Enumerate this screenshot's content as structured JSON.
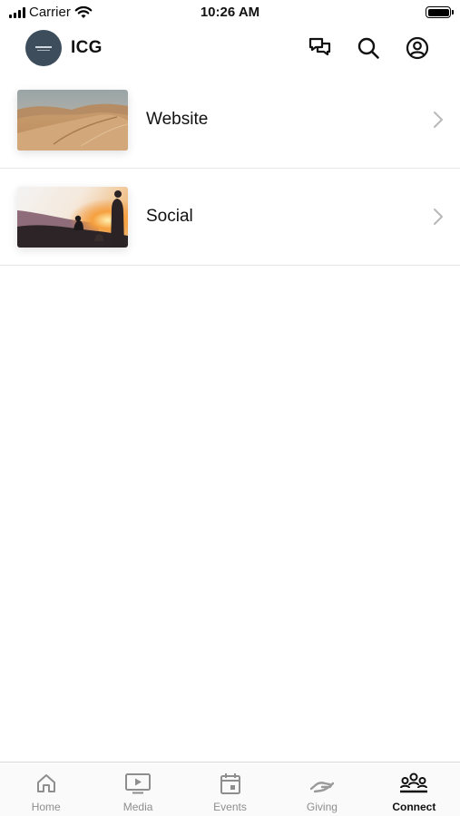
{
  "status_bar": {
    "carrier": "Carrier",
    "time": "10:26 AM"
  },
  "header": {
    "title": "ICG",
    "logo_icon": "church-logo",
    "actions": [
      "chat-icon",
      "search-icon",
      "profile-icon"
    ]
  },
  "list": {
    "items": [
      {
        "label": "Website",
        "thumbnail": "desert-dunes-image",
        "icon": "chevron-right-icon"
      },
      {
        "label": "Social",
        "thumbnail": "sunset-people-image",
        "icon": "chevron-right-icon"
      }
    ]
  },
  "tab_bar": {
    "tabs": [
      {
        "label": "Home",
        "icon": "home-icon",
        "active": false
      },
      {
        "label": "Media",
        "icon": "play-screen-icon",
        "active": false
      },
      {
        "label": "Events",
        "icon": "calendar-icon",
        "active": false
      },
      {
        "label": "Giving",
        "icon": "giving-hand-icon",
        "active": false
      },
      {
        "label": "Connect",
        "icon": "people-group-icon",
        "active": true
      }
    ]
  },
  "colors": {
    "logo_background": "#3d4d5c",
    "inactive_tab": "#8e8e8e",
    "active_tab": "#111111",
    "divider": "#e6e6e6"
  }
}
